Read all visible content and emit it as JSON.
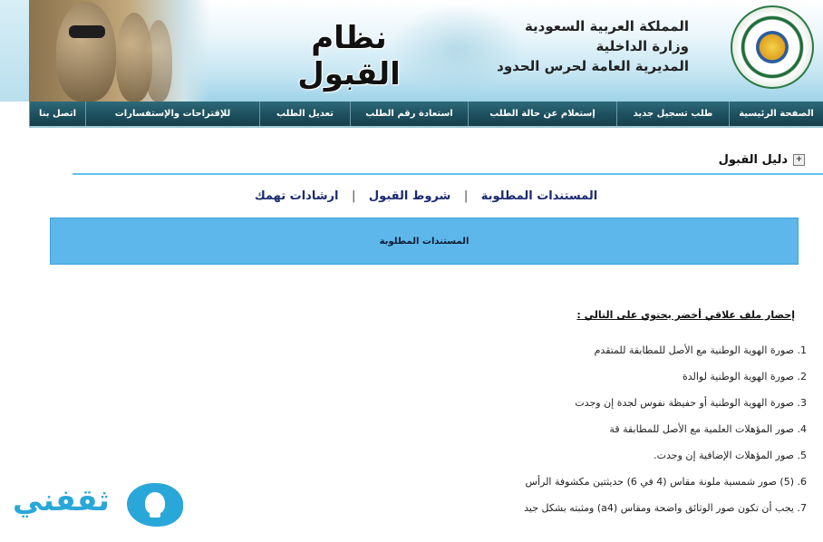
{
  "header": {
    "system_title": "نظام القبول",
    "org_lines": [
      "المملكة العربية السعودية",
      "وزارة الداخلية",
      "المديرية العامة لحرس الحدود"
    ]
  },
  "nav": {
    "items": [
      {
        "label": "الصفحة الرئيسية",
        "width": 104
      },
      {
        "label": "طلب تسجيل جديد",
        "width": 124
      },
      {
        "label": "إستعلام عن حالة الطلب",
        "width": 164
      },
      {
        "label": "استعادة رقم الطلب",
        "width": 130
      },
      {
        "label": "تعديل الطلب",
        "width": 100
      },
      {
        "label": "للإقتراحات والإستفسارات",
        "width": 192
      },
      {
        "label": "اتصل بنا",
        "width": 62
      }
    ]
  },
  "guide": {
    "title": "دليل القبول",
    "expand_icon": "plus-box-icon"
  },
  "links": {
    "required_docs": "المستندات المطلوبة",
    "conditions": "شروط القبول",
    "instructions": "ارشادات تهمك",
    "separator": "|"
  },
  "section": {
    "box_title": "المستندات المطلوبة",
    "intro": "إحضار ملف علاقي أخضر يحتوي على التالي :",
    "items": [
      "1. صورة الهوية الوطنية مع الأصل للمطابقة للمتقدم",
      "2. صورة الهوية الوطنية لوالدة",
      "3. صورة الهوية الوطنية  أو حفيظة نفوس لجدة إن وجدت",
      "4. صور المؤهلات العلمية مع الأصل للمطابقة قة",
      "5. صور المؤهلات الإضافية إن وجدت.",
      "6. (5) صور شمسية ملونة مقاس (4 في 6) حديثتين مكشوفة الرأس",
      "7. يجب أن تكون صور الوثائق واضحة ومقاس (a4) ومثبته بشكل جيد"
    ]
  },
  "watermark": {
    "text": "ثقفني",
    "icon": "lightbulb-icon"
  },
  "colors": {
    "nav_bg": "#1d4f5e",
    "accent_blue": "#5db7ea",
    "rule": "#5cc3e8",
    "watermark": "#2aa7d9"
  }
}
